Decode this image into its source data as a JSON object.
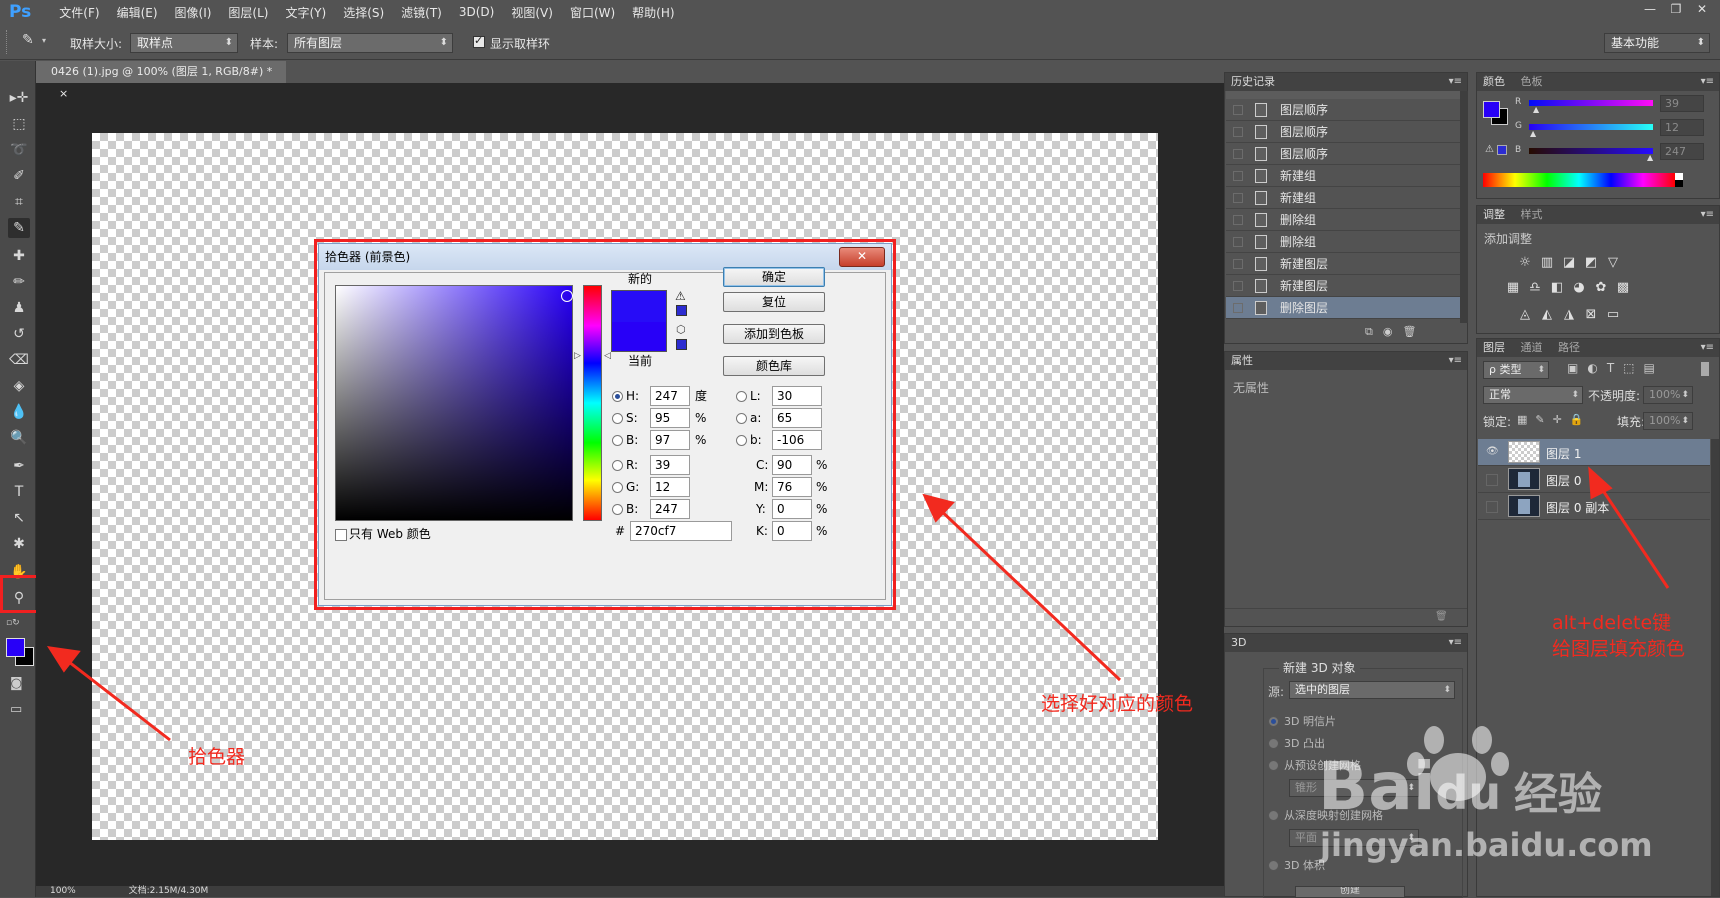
{
  "app": {
    "logo": "Ps"
  },
  "menu": [
    "文件(F)",
    "编辑(E)",
    "图像(I)",
    "图层(L)",
    "文字(Y)",
    "选择(S)",
    "滤镜(T)",
    "3D(D)",
    "视图(V)",
    "窗口(W)",
    "帮助(H)"
  ],
  "window_controls": {
    "minimize": "—",
    "restore": "❐",
    "close": "✕"
  },
  "options_bar": {
    "sample_size_label": "取样大小:",
    "sample_size_value": "取样点",
    "sample_label": "样本:",
    "sample_value": "所有图层",
    "show_ring_label": "显示取样环",
    "show_ring_checked": true,
    "workspace": "基本功能"
  },
  "document": {
    "tab_title": "0426 (1).jpg @ 100% (图层 1, RGB/8#) *",
    "tab_close": "×",
    "status_zoom": "100%",
    "status_doc": "文档:2.15M/4.30M"
  },
  "toolbar": {
    "icons": [
      "move-icon",
      "marquee-icon",
      "lasso-icon",
      "quick-select-icon",
      "crop-icon",
      "eyedropper-icon",
      "healing-icon",
      "brush-icon",
      "stamp-icon",
      "history-brush-icon",
      "eraser-icon",
      "paint-bucket-icon",
      "blur-icon",
      "dodge-icon",
      "pen-icon",
      "type-icon",
      "path-select-icon",
      "shape-icon",
      "hand-icon",
      "zoom-icon"
    ],
    "foreground_color": "#2800f7",
    "background_color": "#000000"
  },
  "color_picker": {
    "title": "拾色器 (前景色)",
    "close": "✕",
    "new_label": "新的",
    "current_label": "当前",
    "new_color": "#270cf7",
    "current_color": "#2800f7",
    "buttons": {
      "ok": "确定",
      "reset": "复位",
      "add_swatch": "添加到色板",
      "libraries": "颜色库"
    },
    "fields": {
      "H": {
        "label": "H:",
        "value": "247",
        "unit": "度"
      },
      "S": {
        "label": "S:",
        "value": "95",
        "unit": "%"
      },
      "Bv": {
        "label": "B:",
        "value": "97",
        "unit": "%"
      },
      "R": {
        "label": "R:",
        "value": "39"
      },
      "G": {
        "label": "G:",
        "value": "12"
      },
      "Bc": {
        "label": "B:",
        "value": "247"
      },
      "L": {
        "label": "L:",
        "value": "30"
      },
      "a": {
        "label": "a:",
        "value": "65"
      },
      "b": {
        "label": "b:",
        "value": "-106"
      },
      "C": {
        "label": "C:",
        "value": "90",
        "unit": "%"
      },
      "M": {
        "label": "M:",
        "value": "76",
        "unit": "%"
      },
      "Y": {
        "label": "Y:",
        "value": "0",
        "unit": "%"
      },
      "K": {
        "label": "K:",
        "value": "0",
        "unit": "%"
      }
    },
    "hex_label": "#",
    "hex_value": "270cf7",
    "web_only_label": "只有 Web 颜色"
  },
  "history_panel": {
    "title": "历史记录",
    "items": [
      "图层顺序",
      "图层顺序",
      "图层顺序",
      "新建组",
      "新建组",
      "删除组",
      "删除组",
      "新建图层",
      "新建图层",
      "删除图层"
    ],
    "selected_index": 9
  },
  "color_panel": {
    "tabs": [
      "颜色",
      "色板"
    ],
    "channels": [
      {
        "label": "R",
        "value": "39"
      },
      {
        "label": "G",
        "value": "12"
      },
      {
        "label": "B",
        "value": "247"
      }
    ]
  },
  "adjustments_panel": {
    "tabs": [
      "调整",
      "样式"
    ],
    "subtitle": "添加调整"
  },
  "layers_panel": {
    "tabs": [
      "图层",
      "通道",
      "路径"
    ],
    "filter_kind": "ρ 类型",
    "blend_mode": "正常",
    "opacity_label": "不透明度:",
    "opacity_value": "100%",
    "lock_label": "锁定:",
    "fill_label": "填充:",
    "fill_value": "100%",
    "layers": [
      {
        "name": "图层 1",
        "visible": true,
        "selected": true
      },
      {
        "name": "图层 0",
        "visible": false,
        "selected": false
      },
      {
        "name": "图层 0 副本",
        "visible": false,
        "selected": false
      }
    ]
  },
  "properties_panel": {
    "title": "属性",
    "empty": "无属性"
  },
  "panel_3d": {
    "title": "3D",
    "section": "新建 3D 对象",
    "source_label": "源:",
    "source_value": "选中的图层",
    "options": [
      "3D 明信片",
      "3D 凸出",
      "从预设创建网格",
      "从深度映射创建网格",
      "3D 体积"
    ],
    "preset_value": "锥形",
    "depth_value": "平面",
    "create_button": "创建"
  },
  "annotations": {
    "picker_tool": "拾色器",
    "choose_color": "选择好对应的颜色",
    "fill_line1": "alt+delete键",
    "fill_line2": "给图层填充颜色"
  },
  "watermark": {
    "brand": "Bai",
    "brand2": "du",
    "cn": "经验",
    "url": "jingyan.baidu.com"
  },
  "colors": {
    "annotation_red": "#f12020",
    "selection_blue": "#6d7d92"
  }
}
